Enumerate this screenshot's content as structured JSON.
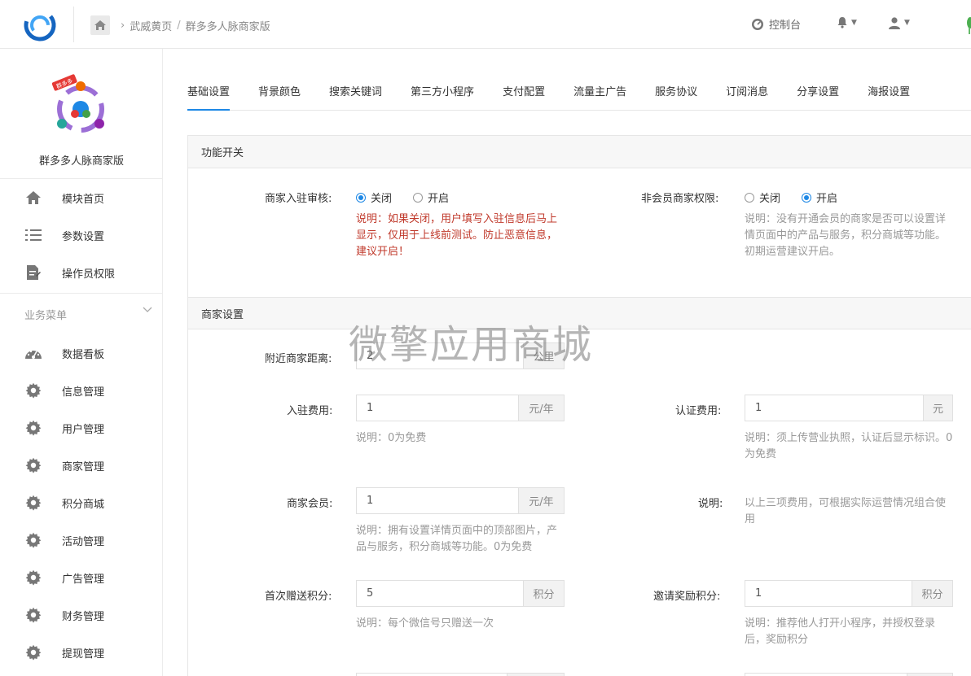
{
  "header": {
    "breadcrumb": [
      "武威黄页",
      "群多多人脉商家版"
    ],
    "breadcrumb_sep": "/",
    "console_label": "控制台"
  },
  "sidebar": {
    "brand_name": "群多多人脉商家版",
    "brand_badge": "群多多",
    "top_items": [
      {
        "label": "模块首页",
        "icon": "home-icon"
      },
      {
        "label": "参数设置",
        "icon": "list-icon"
      },
      {
        "label": "操作员权限",
        "icon": "document-edit-icon"
      }
    ],
    "section_title": "业务菜单",
    "business_items": [
      {
        "label": "数据看板",
        "icon": "dashboard-icon"
      },
      {
        "label": "信息管理",
        "icon": "gear-icon"
      },
      {
        "label": "用户管理",
        "icon": "gear-icon"
      },
      {
        "label": "商家管理",
        "icon": "gear-icon"
      },
      {
        "label": "积分商城",
        "icon": "gear-icon"
      },
      {
        "label": "活动管理",
        "icon": "gear-icon"
      },
      {
        "label": "广告管理",
        "icon": "gear-icon"
      },
      {
        "label": "财务管理",
        "icon": "gear-icon"
      },
      {
        "label": "提现管理",
        "icon": "gear-icon"
      }
    ]
  },
  "tabs": [
    "基础设置",
    "背景颜色",
    "搜索关键词",
    "第三方小程序",
    "支付配置",
    "流量主广告",
    "服务协议",
    "订阅消息",
    "分享设置",
    "海报设置"
  ],
  "active_tab": 0,
  "function_switch": {
    "title": "功能开关",
    "merchant_review": {
      "label": "商家入驻审核:",
      "options": [
        "关闭",
        "开启"
      ],
      "selected": 0,
      "note": "说明：如果关闭，用户填写入驻信息后马上显示，仅用于上线前测试。防止恶意信息，建议开启！"
    },
    "non_member_rights": {
      "label": "非会员商家权限:",
      "options": [
        "关闭",
        "开启"
      ],
      "selected": 1,
      "note": "说明：没有开通会员的商家是否可以设置详情页面中的产品与服务，积分商城等功能。初期运营建议开启。"
    }
  },
  "merchant_settings": {
    "title": "商家设置",
    "nearby_distance": {
      "label": "附近商家距离:",
      "value": "2",
      "unit": "公里"
    },
    "entry_fee": {
      "label": "入驻费用:",
      "value": "1",
      "unit": "元/年",
      "note": "说明：0为免费"
    },
    "cert_fee": {
      "label": "认证费用:",
      "value": "1",
      "unit": "元",
      "note": "说明：须上传营业执照，认证后显示标识。0为免费"
    },
    "member": {
      "label": "商家会员:",
      "value": "1",
      "unit": "元/年",
      "note": "说明：拥有设置详情页面中的顶部图片，产品与服务，积分商城等功能。0为免费"
    },
    "explain": {
      "label": "说明:",
      "note": "以上三项费用，可根据实际运营情况组合使用"
    },
    "first_points": {
      "label": "首次赠送积分:",
      "value": "5",
      "unit": "积分",
      "note": "说明：每个微信号只赠送一次"
    },
    "invite_points": {
      "label": "邀请奖励积分:",
      "value": "1",
      "unit": "积分",
      "note": "说明：推荐他人打开小程序，并授权登录后，奖励积分"
    }
  },
  "watermark": "微擎应用商城",
  "colors": {
    "accent": "#1e88e5",
    "note_red": "#c0392b"
  }
}
